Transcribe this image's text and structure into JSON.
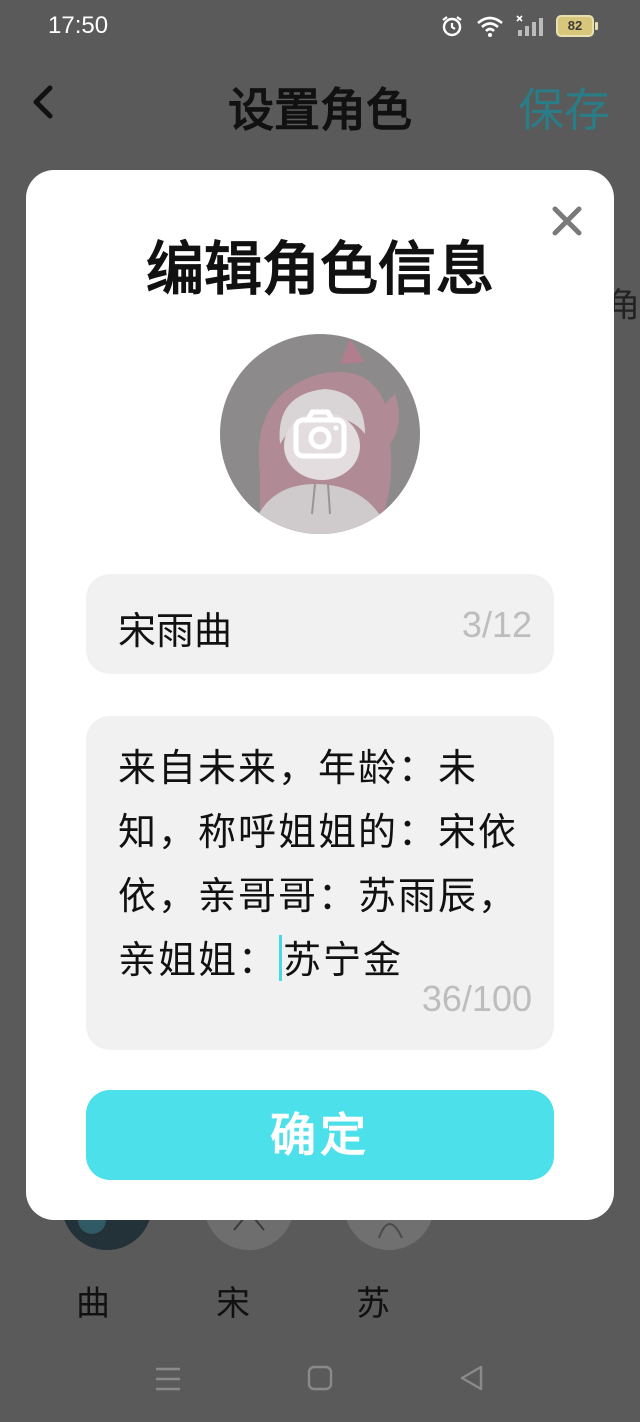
{
  "status_bar": {
    "time": "17:50",
    "battery": "82"
  },
  "header": {
    "title": "设置角色",
    "save_label": "保存"
  },
  "background": {
    "peek_text": "角",
    "bottom_avatars": [
      {
        "name": "曲"
      },
      {
        "name": "宋"
      },
      {
        "name": "苏"
      }
    ]
  },
  "dialog": {
    "title": "编辑角色信息",
    "name_value": "宋雨曲",
    "name_count": "3/12",
    "description_before_cursor": "来自未来，年龄：未知，称呼姐姐的：宋依依，亲哥哥：苏雨辰，亲姐姐：",
    "description_after_cursor": "苏宁金",
    "description_count": "36/100",
    "confirm_label": "确定"
  },
  "icons": {
    "back": "chevron-left-icon",
    "close": "close-icon",
    "camera": "camera-icon",
    "alarm": "alarm-icon",
    "wifi": "wifi-icon",
    "signal": "signal-icon",
    "nav_menu": "menu-icon",
    "nav_home": "home-icon",
    "nav_back": "back-triangle-icon"
  },
  "colors": {
    "accent": "#4be0ea",
    "save_text": "#2a7c86",
    "overlay": "#5a5a5a"
  }
}
